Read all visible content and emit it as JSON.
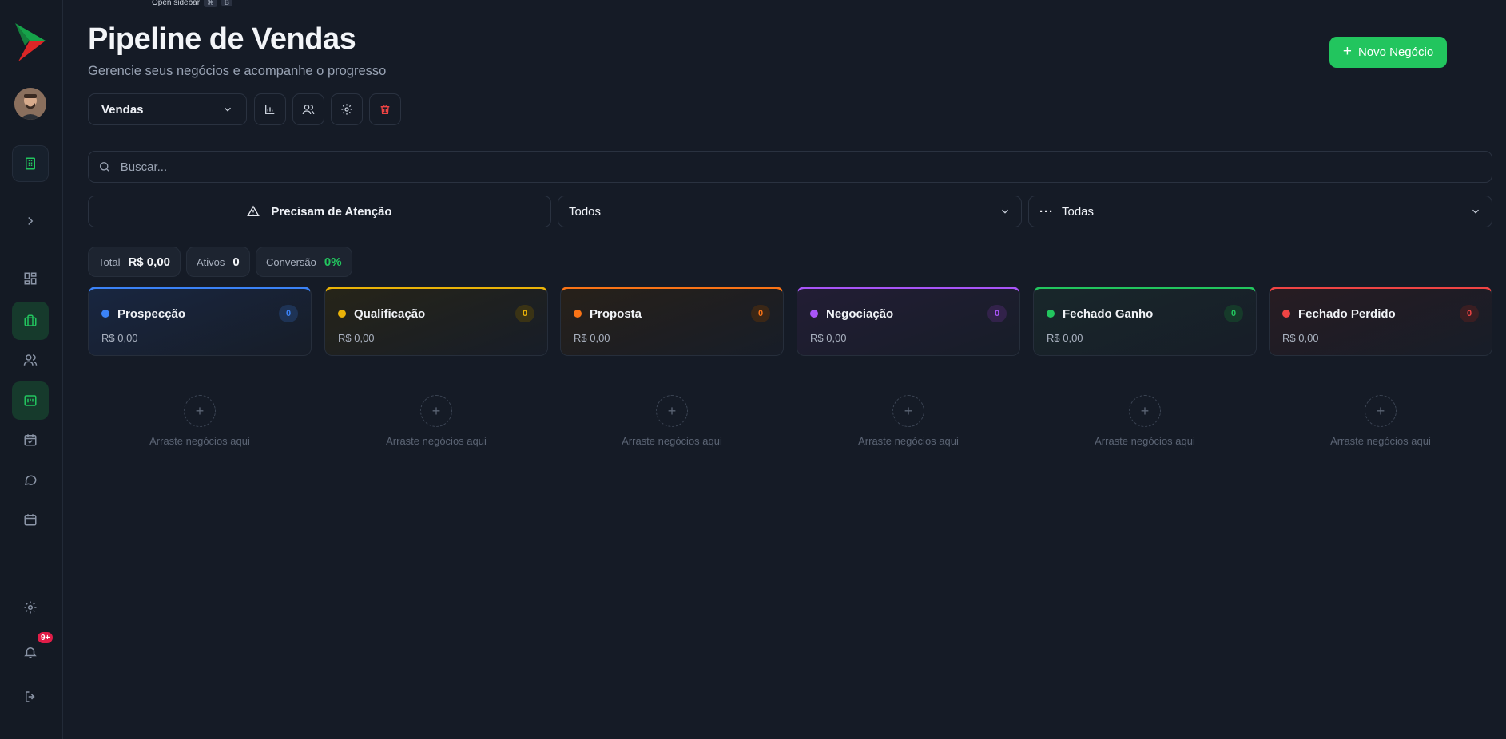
{
  "tooltip": {
    "text": "Open sidebar",
    "keys": [
      "⌘",
      "B"
    ]
  },
  "sidebar": {
    "notifications_badge": "9+",
    "items": [
      {
        "name": "building-icon"
      },
      {
        "name": "chevron-right-icon"
      },
      {
        "name": "dashboard-icon"
      },
      {
        "name": "briefcase-icon"
      },
      {
        "name": "users-icon"
      },
      {
        "name": "pipeline-icon"
      },
      {
        "name": "calendar-check-icon"
      },
      {
        "name": "chat-icon"
      },
      {
        "name": "calendar-icon"
      },
      {
        "name": "settings-icon"
      },
      {
        "name": "bell-icon"
      },
      {
        "name": "logout-icon"
      }
    ]
  },
  "header": {
    "title": "Pipeline de Vendas",
    "subtitle": "Gerencie seus negócios e acompanhe o progresso",
    "new_button": "Novo Negócio"
  },
  "toolbar": {
    "pipeline_selected": "Vendas",
    "icons": [
      "bar-chart-icon",
      "users-icon",
      "gear-icon",
      "trash-icon"
    ]
  },
  "search": {
    "placeholder": "Buscar..."
  },
  "filters": {
    "attention": "Precisam de Atenção",
    "status": "Todos",
    "priority": "Todas"
  },
  "stats": {
    "total_label": "Total",
    "total_value": "R$ 0,00",
    "active_label": "Ativos",
    "active_value": "0",
    "conversion_label": "Conversão",
    "conversion_value": "0%"
  },
  "drop_text": "Arraste negócios aqui",
  "columns": [
    {
      "name": "Prospecção",
      "count": "0",
      "amount": "R$ 0,00",
      "color": "#3b82f6",
      "bg": "#182640",
      "cbg": "#1e3355"
    },
    {
      "name": "Qualificação",
      "count": "0",
      "amount": "R$ 0,00",
      "color": "#eab308",
      "bg": "#262418",
      "cbg": "#3a3315"
    },
    {
      "name": "Proposta",
      "count": "0",
      "amount": "R$ 0,00",
      "color": "#f97316",
      "bg": "#272019",
      "cbg": "#3b2716"
    },
    {
      "name": "Negociação",
      "count": "0",
      "amount": "R$ 0,00",
      "color": "#a855f7",
      "bg": "#221d34",
      "cbg": "#32224a"
    },
    {
      "name": "Fechado Ganho",
      "count": "0",
      "amount": "R$ 0,00",
      "color": "#22c55e",
      "bg": "#18272a",
      "cbg": "#163a2a"
    },
    {
      "name": "Fechado Perdido",
      "count": "0",
      "amount": "R$ 0,00",
      "color": "#ef4444",
      "bg": "#271c22",
      "cbg": "#3a1e22"
    }
  ]
}
